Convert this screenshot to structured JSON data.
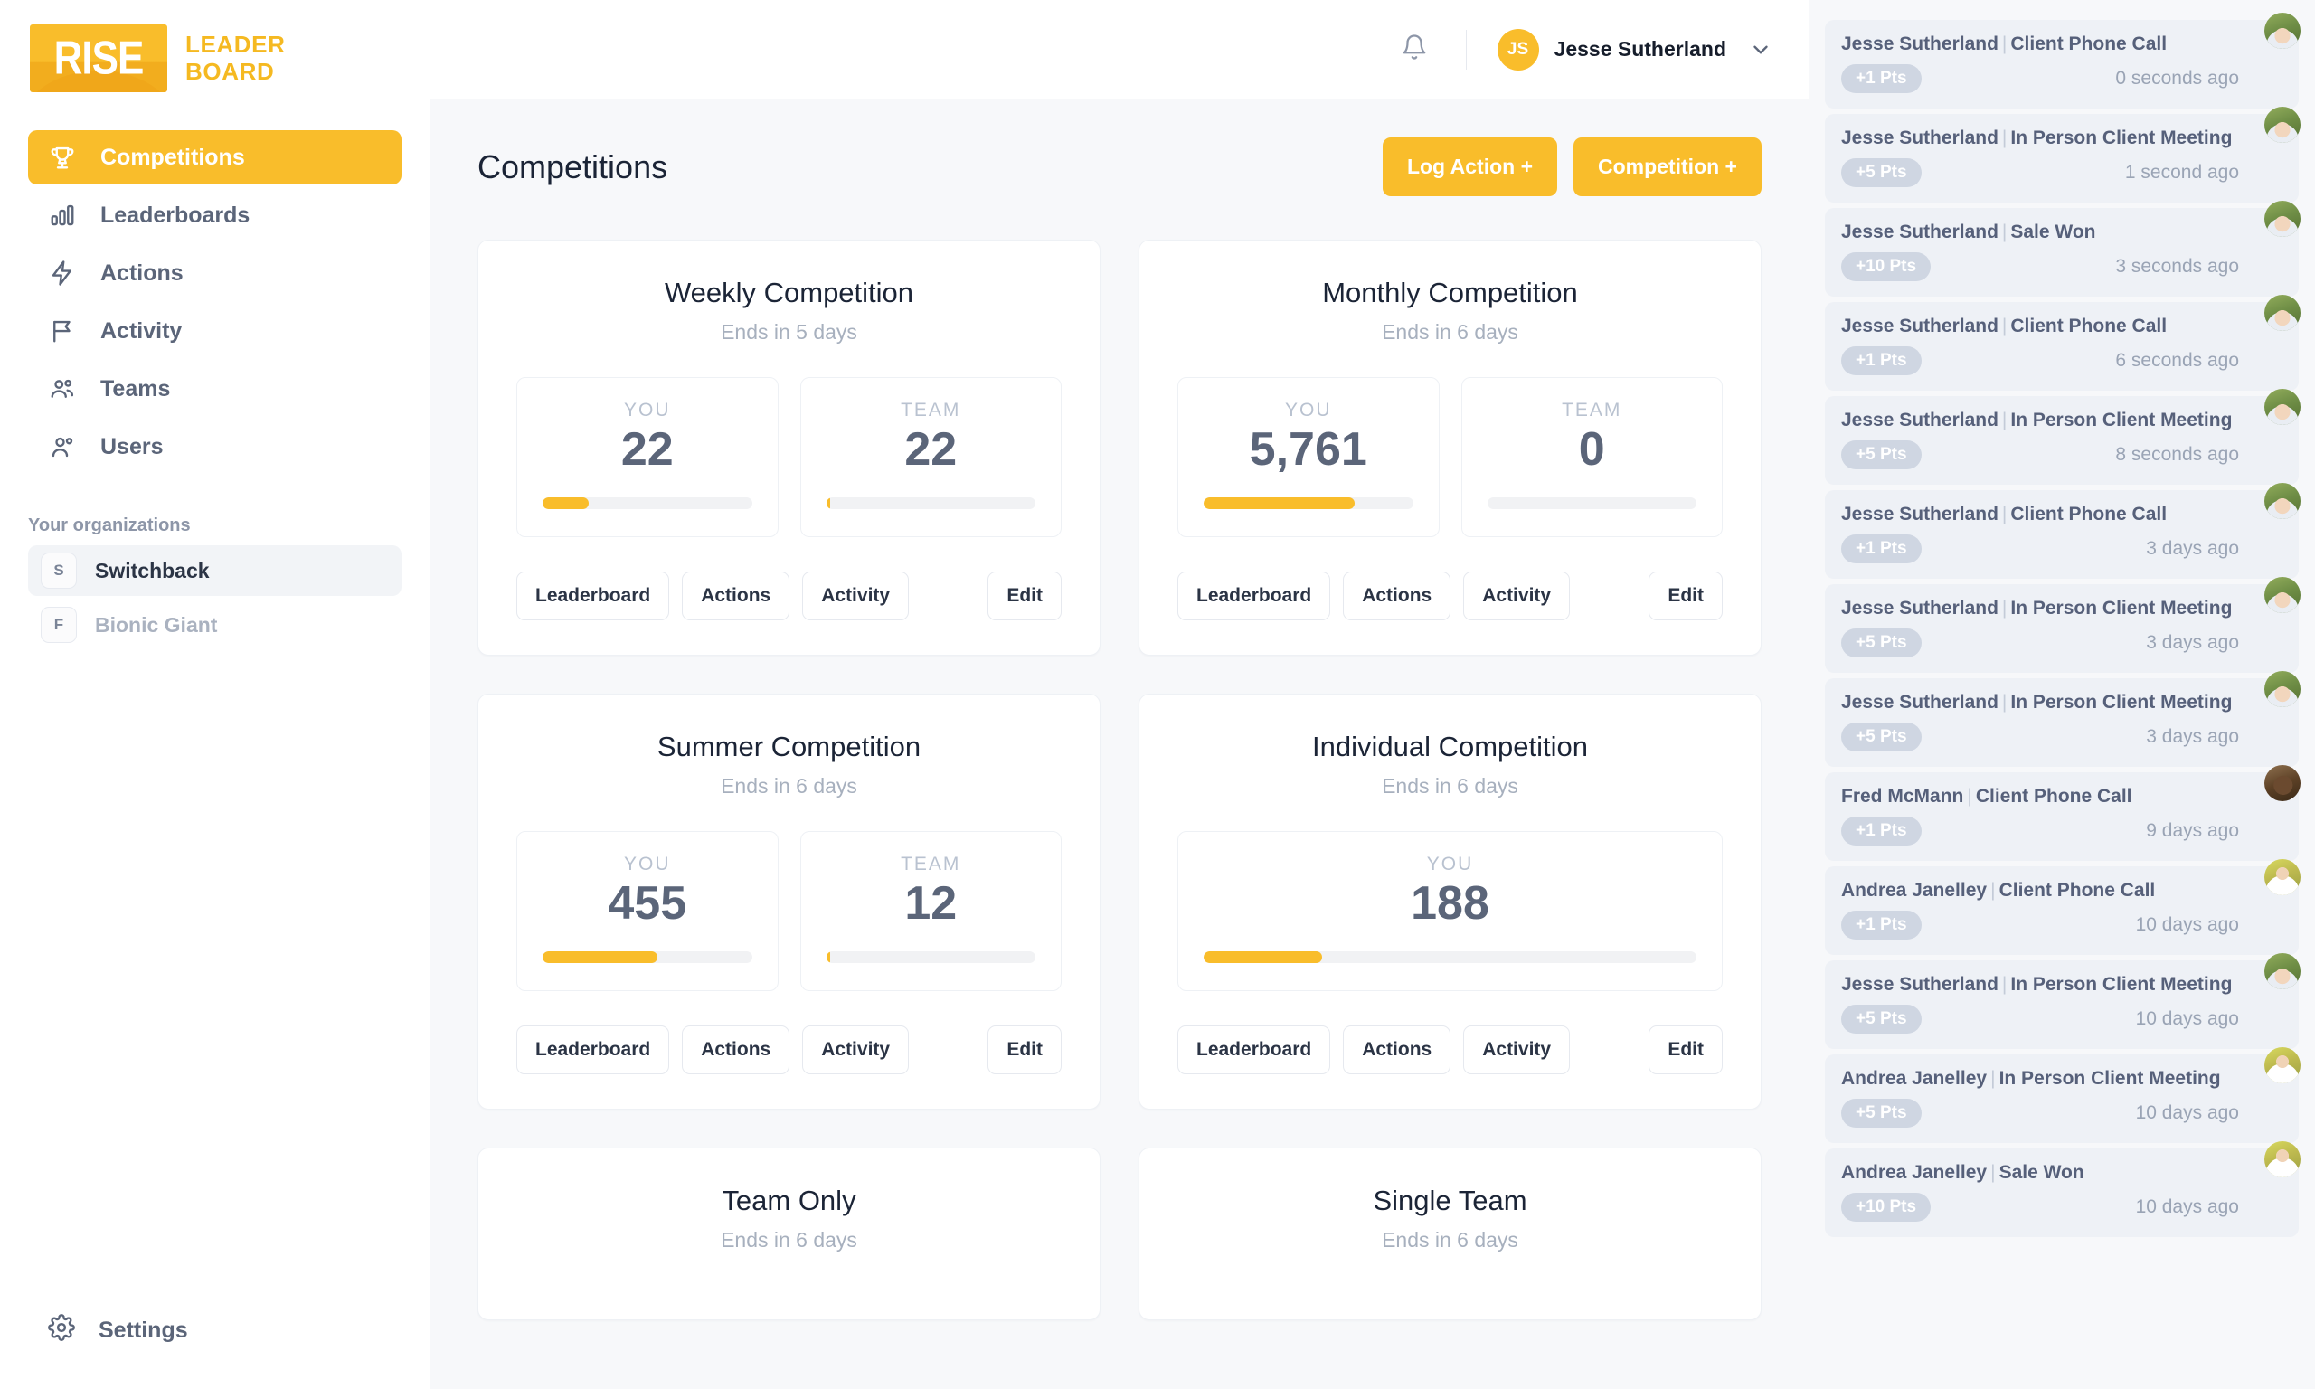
{
  "brand": {
    "logo_mark_text": "RISE",
    "logo_word_line1": "LEADER",
    "logo_word_line2": "BOARD",
    "accent_color": "#f9bd2b"
  },
  "sidebar": {
    "nav_items": [
      {
        "label": "Competitions",
        "icon": "trophy-icon",
        "active": true
      },
      {
        "label": "Leaderboards",
        "icon": "bar-chart-icon",
        "active": false
      },
      {
        "label": "Actions",
        "icon": "lightning-bolt-icon",
        "active": false
      },
      {
        "label": "Activity",
        "icon": "flag-icon",
        "active": false
      },
      {
        "label": "Teams",
        "icon": "users-group-icon",
        "active": false
      },
      {
        "label": "Users",
        "icon": "users-icon",
        "active": false
      }
    ],
    "orgs_label": "Your organizations",
    "orgs": [
      {
        "initial": "S",
        "name": "Switchback",
        "active": true
      },
      {
        "initial": "F",
        "name": "Bionic Giant",
        "active": false
      }
    ],
    "settings_label": "Settings",
    "settings_icon": "gear-icon"
  },
  "topbar": {
    "bell_icon": "bell-icon",
    "user_initials": "JS",
    "user_name": "Jesse Sutherland",
    "chevron_icon": "chevron-down-icon"
  },
  "main": {
    "page_title": "Competitions",
    "log_action_label": "Log Action +",
    "competition_label": "Competition +",
    "cards": [
      {
        "title": "Weekly Competition",
        "subtitle": "Ends in 5 days",
        "stats": [
          {
            "label": "YOU",
            "value": "22",
            "progress": 22
          },
          {
            "label": "TEAM",
            "value": "22",
            "progress": 2
          }
        ],
        "actions": [
          "Leaderboard",
          "Actions",
          "Activity"
        ],
        "edit_label": "Edit"
      },
      {
        "title": "Monthly Competition",
        "subtitle": "Ends in 6 days",
        "stats": [
          {
            "label": "YOU",
            "value": "5,761",
            "progress": 72
          },
          {
            "label": "TEAM",
            "value": "0",
            "progress": 0
          }
        ],
        "actions": [
          "Leaderboard",
          "Actions",
          "Activity"
        ],
        "edit_label": "Edit"
      },
      {
        "title": "Summer Competition",
        "subtitle": "Ends in 6 days",
        "stats": [
          {
            "label": "YOU",
            "value": "455",
            "progress": 55
          },
          {
            "label": "TEAM",
            "value": "12",
            "progress": 1
          }
        ],
        "actions": [
          "Leaderboard",
          "Actions",
          "Activity"
        ],
        "edit_label": "Edit"
      },
      {
        "title": "Individual Competition",
        "subtitle": "Ends in 6 days",
        "stats": [
          {
            "label": "YOU",
            "value": "188",
            "progress": 24
          }
        ],
        "actions": [
          "Leaderboard",
          "Actions",
          "Activity"
        ],
        "edit_label": "Edit"
      },
      {
        "title": "Team Only",
        "subtitle": "Ends in 6 days",
        "stats": [],
        "actions": [],
        "edit_label": ""
      },
      {
        "title": "Single Team",
        "subtitle": "Ends in 6 days",
        "stats": [],
        "actions": [],
        "edit_label": ""
      }
    ]
  },
  "activity_feed": {
    "items": [
      {
        "user": "Jesse Sutherland",
        "action": "Client Phone Call",
        "points": "+1 Pts",
        "ago": "0 seconds ago",
        "avatar": "jesse"
      },
      {
        "user": "Jesse Sutherland",
        "action": "In Person Client Meeting",
        "points": "+5 Pts",
        "ago": "1 second ago",
        "avatar": "jesse"
      },
      {
        "user": "Jesse Sutherland",
        "action": "Sale Won",
        "points": "+10 Pts",
        "ago": "3 seconds ago",
        "avatar": "jesse"
      },
      {
        "user": "Jesse Sutherland",
        "action": "Client Phone Call",
        "points": "+1 Pts",
        "ago": "6 seconds ago",
        "avatar": "jesse"
      },
      {
        "user": "Jesse Sutherland",
        "action": "In Person Client Meeting",
        "points": "+5 Pts",
        "ago": "8 seconds ago",
        "avatar": "jesse"
      },
      {
        "user": "Jesse Sutherland",
        "action": "Client Phone Call",
        "points": "+1 Pts",
        "ago": "3 days ago",
        "avatar": "jesse"
      },
      {
        "user": "Jesse Sutherland",
        "action": "In Person Client Meeting",
        "points": "+5 Pts",
        "ago": "3 days ago",
        "avatar": "jesse"
      },
      {
        "user": "Jesse Sutherland",
        "action": "In Person Client Meeting",
        "points": "+5 Pts",
        "ago": "3 days ago",
        "avatar": "jesse"
      },
      {
        "user": "Fred McMann",
        "action": "Client Phone Call",
        "points": "+1 Pts",
        "ago": "9 days ago",
        "avatar": "fred"
      },
      {
        "user": "Andrea Janelley",
        "action": "Client Phone Call",
        "points": "+1 Pts",
        "ago": "10 days ago",
        "avatar": "andrea"
      },
      {
        "user": "Jesse Sutherland",
        "action": "In Person Client Meeting",
        "points": "+5 Pts",
        "ago": "10 days ago",
        "avatar": "jesse"
      },
      {
        "user": "Andrea Janelley",
        "action": "In Person Client Meeting",
        "points": "+5 Pts",
        "ago": "10 days ago",
        "avatar": "andrea"
      },
      {
        "user": "Andrea Janelley",
        "action": "Sale Won",
        "points": "+10 Pts",
        "ago": "10 days ago",
        "avatar": "andrea"
      }
    ]
  }
}
